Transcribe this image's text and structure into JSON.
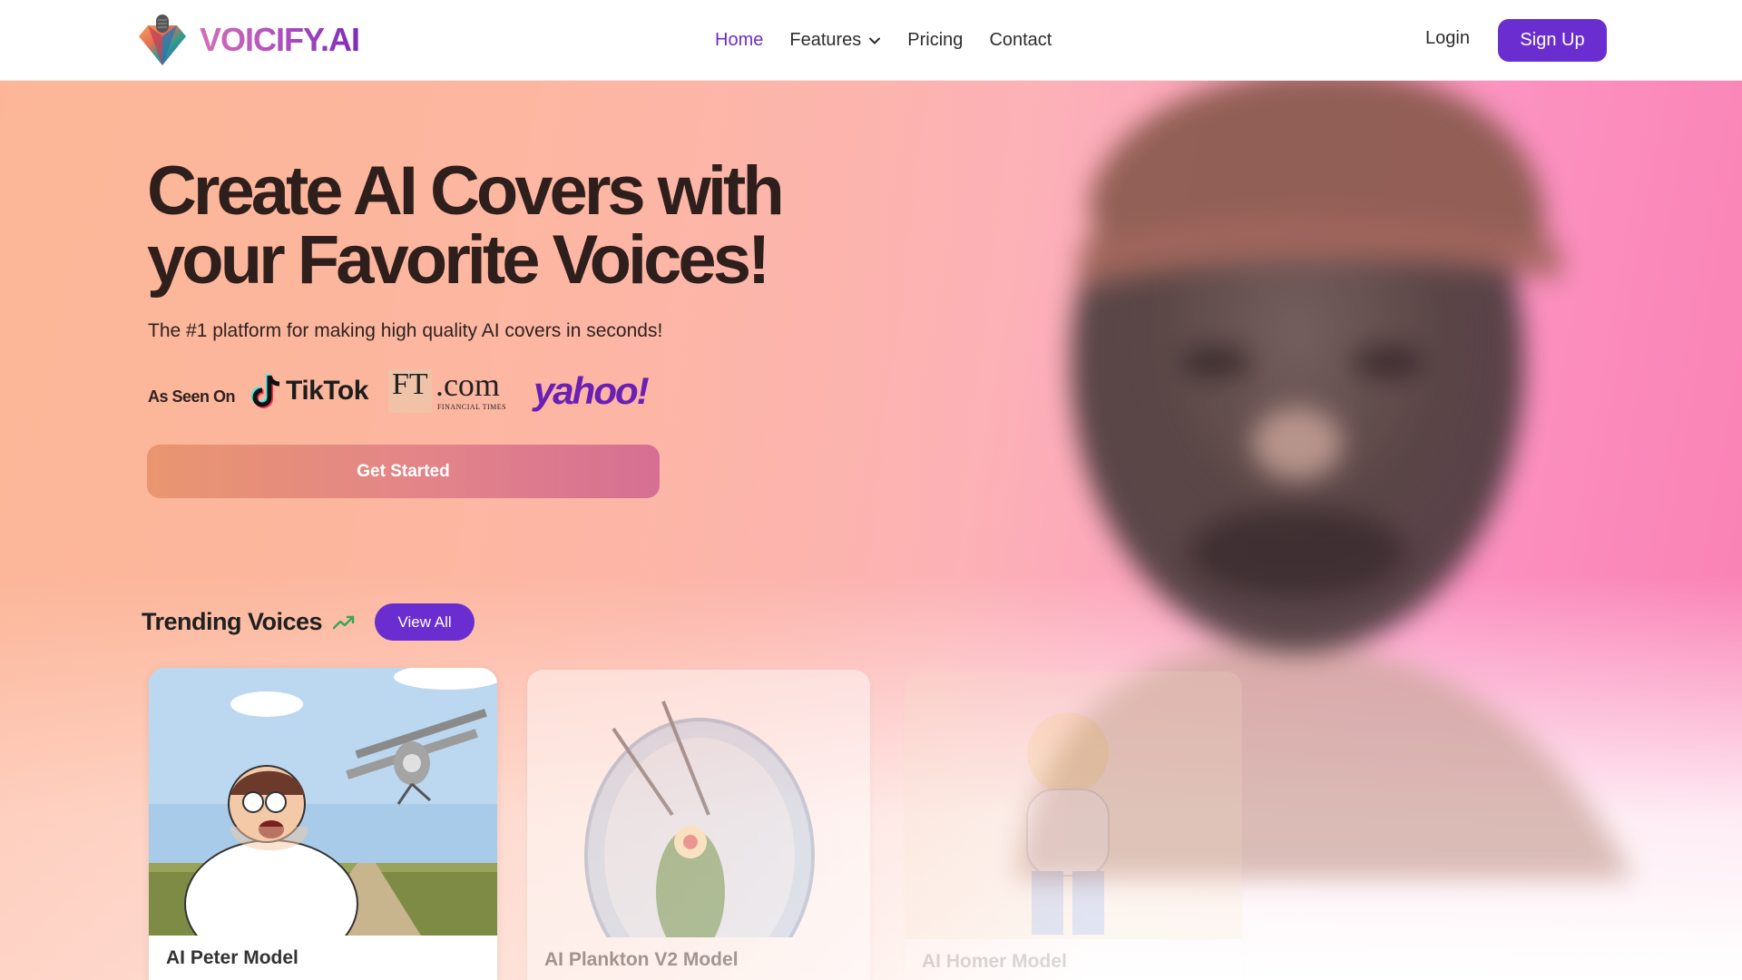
{
  "brand": {
    "name": "VOICIFY.AI",
    "colors": {
      "primary": "#6a2ed0",
      "gradient_start": "#e99670",
      "gradient_end": "#d66f93"
    }
  },
  "nav": {
    "items": [
      {
        "label": "Home",
        "active": true
      },
      {
        "label": "Features",
        "icon": "chevron-down-icon"
      },
      {
        "label": "Pricing"
      },
      {
        "label": "Contact"
      }
    ],
    "login": "Login",
    "signup": "Sign Up"
  },
  "hero": {
    "headline": "Create AI Covers with your Favorite Voices!",
    "subhead": "The #1 platform for making high quality AI covers in seconds!",
    "seen_on_label": "As Seen On",
    "press": {
      "tiktok": "TikTok",
      "ft_letters": "FT",
      "ft_dotcom": ".com",
      "ft_sub": "FINANCIAL TIMES",
      "yahoo": "yahoo!"
    },
    "cta": "Get Started"
  },
  "trending": {
    "title": "Trending Voices",
    "view_all": "View All",
    "cards": [
      {
        "title": "AI Peter Model",
        "meta": ""
      },
      {
        "title": "AI Plankton V2 Model",
        "meta": ""
      },
      {
        "title": "AI Homer Model",
        "meta": ""
      }
    ]
  }
}
